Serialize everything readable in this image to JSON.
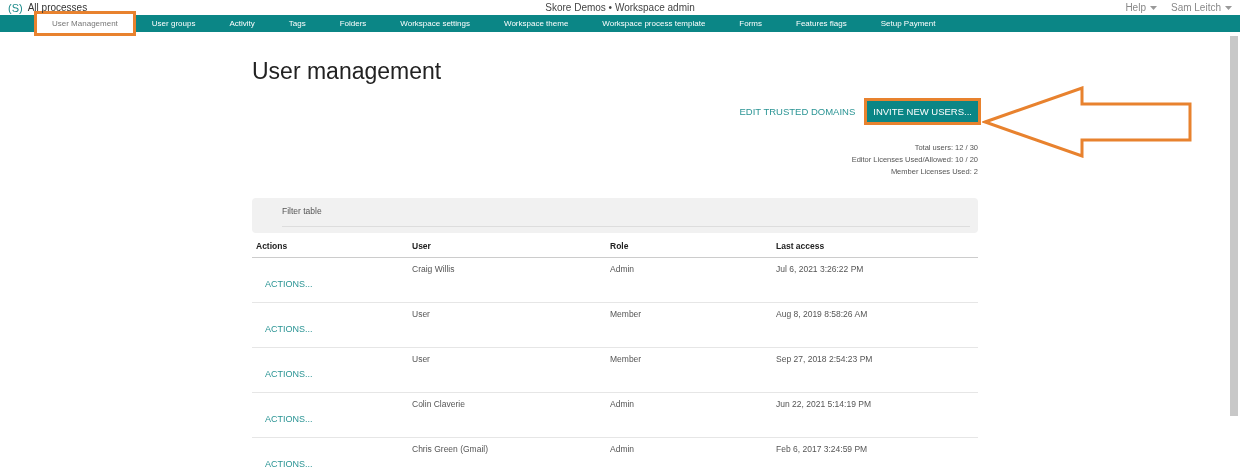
{
  "header": {
    "logo": "(S)",
    "breadcrumb": "All processes",
    "title": "Skore Demos • Workspace admin",
    "menus": [
      {
        "label": "Help"
      },
      {
        "label": "Sam Leitch"
      }
    ]
  },
  "nav": [
    {
      "label": "User Management",
      "selected": true,
      "highlighted": true
    },
    {
      "label": "User groups",
      "selected": false,
      "highlighted": false
    },
    {
      "label": "Activity",
      "selected": false,
      "highlighted": false
    },
    {
      "label": "Tags",
      "selected": false,
      "highlighted": false
    },
    {
      "label": "Folders",
      "selected": false,
      "highlighted": false
    },
    {
      "label": "Workspace settings",
      "selected": false,
      "highlighted": false
    },
    {
      "label": "Workspace theme",
      "selected": false,
      "highlighted": false
    },
    {
      "label": "Workspace process template",
      "selected": false,
      "highlighted": false
    },
    {
      "label": "Forms",
      "selected": false,
      "highlighted": false
    },
    {
      "label": "Features flags",
      "selected": false,
      "highlighted": false
    },
    {
      "label": "Setup Payment",
      "selected": false,
      "highlighted": false
    }
  ],
  "page_title": "User management",
  "actions": {
    "link": "EDIT TRUSTED DOMAINS",
    "button": {
      "label": "INVITE NEW USERS...",
      "highlighted": true
    },
    "arrow": true
  },
  "stats": [
    "Total users: 12 / 30",
    "Editor Licenses Used/Allowed: 10 / 20",
    "Member Licenses Used: 2"
  ],
  "filter": {
    "placeholder": "Filter table"
  },
  "table": {
    "columns": [
      "Actions",
      "User",
      "Role",
      "Last access"
    ],
    "rows": [
      {
        "action": "ACTIONS...",
        "user": "Craig Willis",
        "role": "Admin",
        "last_access": "Jul 6, 2021 3:26:22 PM"
      },
      {
        "action": "ACTIONS...",
        "user": "User",
        "role": "Member",
        "last_access": "Aug 8, 2019 8:58:26 AM"
      },
      {
        "action": "ACTIONS...",
        "user": "User",
        "role": "Member",
        "last_access": "Sep 27, 2018 2:54:23 PM"
      },
      {
        "action": "ACTIONS...",
        "user": "Colin Claverie",
        "role": "Admin",
        "last_access": "Jun 22, 2021 5:14:19 PM"
      },
      {
        "action": "ACTIONS...",
        "user": "Chris Green (Gmail)",
        "role": "Admin",
        "last_access": "Feb 6, 2017 3:24:59 PM"
      }
    ]
  }
}
